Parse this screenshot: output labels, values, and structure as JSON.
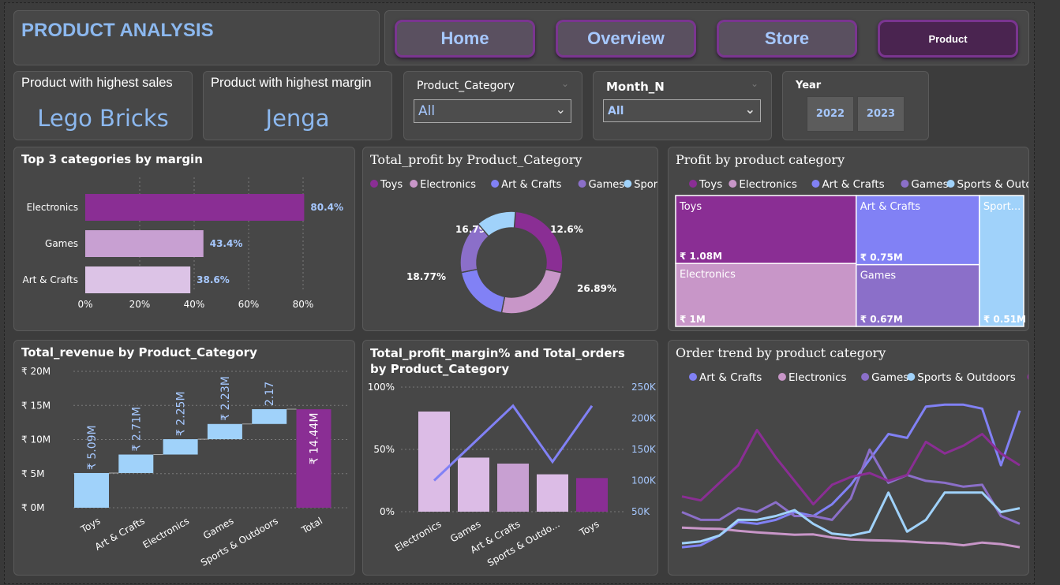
{
  "header": {
    "title": "PRODUCT ANALYSIS",
    "nav": [
      {
        "label": "Home",
        "active": false
      },
      {
        "label": "Overview",
        "active": false
      },
      {
        "label": "Store",
        "active": false
      },
      {
        "label": "Product",
        "active": true
      }
    ]
  },
  "kpis": [
    {
      "label": "Product with highest sales",
      "value": "Lego Bricks"
    },
    {
      "label": "Product with highest margin",
      "value": "Jenga"
    }
  ],
  "filters": {
    "category": {
      "label": "Product_Category",
      "value": "All"
    },
    "month": {
      "label": "Month_N",
      "value": "All"
    },
    "year": {
      "label": "Year",
      "options": [
        "2022",
        "2023"
      ]
    }
  },
  "colors": {
    "Toys": "#8a2e94",
    "Electronics": "#c896c8",
    "Art & Crafts": "#8181f5",
    "Games": "#8b6fc9",
    "Sports & Outdoors": "#a0d2fa",
    "accent_text": "#a6c8ff"
  },
  "chart_data": [
    {
      "id": "top3",
      "type": "bar",
      "title": "Top 3 categories by margin",
      "categories": [
        "Electronics",
        "Games",
        "Art & Crafts"
      ],
      "values": [
        80.4,
        43.4,
        38.6
      ],
      "value_labels": [
        "80.4%",
        "43.4%",
        "38.6%"
      ],
      "bar_colors": [
        "#8a2e94",
        "#c8a0d2",
        "#dcc3e6"
      ],
      "xticks": [
        "0%",
        "20%",
        "40%",
        "60%",
        "80%"
      ],
      "xlim": [
        0,
        80
      ]
    },
    {
      "id": "donut",
      "type": "pie",
      "title": "Total_profit by Product_Category",
      "legend": [
        "Toys",
        "Electronics",
        "Art & Crafts",
        "Games",
        "Sports &..."
      ],
      "labels": [
        "Toys",
        "Electronics",
        "Art & Crafts",
        "Games",
        "Sports & Outdoors"
      ],
      "values": [
        26.89,
        24.95,
        18.77,
        16.79,
        12.6
      ],
      "value_labels": [
        "26.89%",
        "24.95%",
        "18.77%",
        "16.79%",
        "12.6%"
      ]
    },
    {
      "id": "treemap",
      "type": "treemap",
      "title": "Profit by product category",
      "legend": [
        "Toys",
        "Electronics",
        "Art & Crafts",
        "Games",
        "Sports & Outdoors"
      ],
      "items": [
        {
          "name": "Toys",
          "label": "Toys",
          "value": 1.08,
          "value_label": "₹ 1.08M"
        },
        {
          "name": "Electronics",
          "label": "Electronics",
          "value": 1.0,
          "value_label": "₹ 1M"
        },
        {
          "name": "Art & Crafts",
          "label": "Art & Crafts",
          "value": 0.75,
          "value_label": "₹ 0.75M"
        },
        {
          "name": "Games",
          "label": "Games",
          "value": 0.67,
          "value_label": "₹ 0.67M"
        },
        {
          "name": "Sports & Outdoors",
          "label": "Sport...",
          "value": 0.51,
          "value_label": "₹ 0.51M"
        }
      ]
    },
    {
      "id": "waterfall",
      "type": "bar",
      "title": "Total_revenue by Product_Category",
      "categories": [
        "Toys",
        "Art & Crafts",
        "Electronics",
        "Games",
        "Sports & Outdoors",
        "Total"
      ],
      "values": [
        5.09,
        2.71,
        2.25,
        2.23,
        2.17,
        14.44
      ],
      "value_labels": [
        "₹ 5.09M",
        "₹ 2.71M",
        "₹ 2.25M",
        "₹ 2.23M",
        "2.17",
        "₹ 14.44M"
      ],
      "yticks": [
        "₹ 0M",
        "₹ 5M",
        "₹ 10M",
        "₹ 15M",
        "₹ 20M"
      ],
      "ylim": [
        0,
        20
      ]
    },
    {
      "id": "combo",
      "type": "bar",
      "title": "Total_profit_margin% and Total_orders by Product_Category",
      "categories": [
        "Electronics",
        "Games",
        "Art & Crafts",
        "Sports & Outdo...",
        "Toys"
      ],
      "series": [
        {
          "name": "Total_profit_margin%",
          "values": [
            80.4,
            43.4,
            38.6,
            30.0,
            27.0
          ]
        },
        {
          "name": "Total_orders",
          "values": [
            100000,
            160000,
            220000,
            130000,
            220000
          ]
        }
      ],
      "bar_colors": [
        "#dcbce6",
        "#dcbce6",
        "#c8a0d2",
        "#dcbce6",
        "#8a2e94"
      ],
      "yticks_left": [
        "0%",
        "50%",
        "100%"
      ],
      "ylim_left": [
        0,
        100
      ],
      "yticks_right": [
        "50K",
        "100K",
        "150K",
        "200K",
        "250K"
      ],
      "ylim_right": [
        50000,
        250000
      ]
    },
    {
      "id": "trend",
      "type": "line",
      "title": "Order trend by product category",
      "series": [
        {
          "name": "Art & Crafts",
          "values": [
            100,
            105,
            130,
            165,
            160,
            170,
            190,
            180,
            210,
            260,
            325,
            390,
            380,
            460,
            465,
            465,
            455,
            310,
            450
          ]
        },
        {
          "name": "Electronics",
          "values": [
            150,
            148,
            147,
            142,
            138,
            135,
            132,
            133,
            125,
            120,
            118,
            117,
            115,
            112,
            110,
            105,
            112,
            108,
            100
          ]
        },
        {
          "name": "Games",
          "values": [
            190,
            170,
            170,
            200,
            190,
            215,
            180,
            180,
            170,
            225,
            350,
            265,
            285,
            270,
            265,
            255,
            260,
            180,
            160
          ]
        },
        {
          "name": "Sports & Outdoors",
          "values": [
            110,
            115,
            130,
            170,
            170,
            180,
            195,
            160,
            135,
            130,
            140,
            240,
            140,
            170,
            240,
            240,
            240,
            190,
            200
          ]
        },
        {
          "name": "Toys",
          "values": [
            230,
            220,
            265,
            310,
            400,
            330,
            270,
            210,
            260,
            280,
            290,
            270,
            285,
            370,
            340,
            360,
            390,
            340,
            310
          ]
        }
      ]
    }
  ]
}
